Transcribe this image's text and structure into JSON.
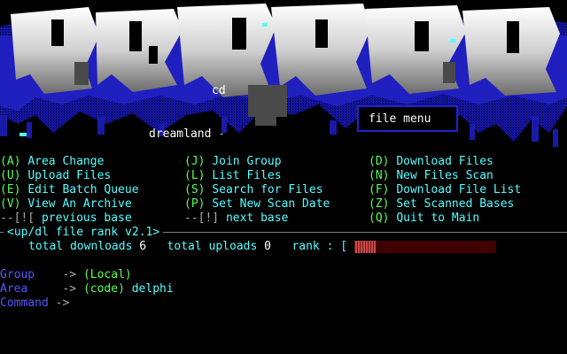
{
  "banner": {
    "tag": "cd",
    "menu_title": "file menu",
    "bbs_name": "dreamland",
    "bbs_suffix": "-"
  },
  "menu": {
    "col1": [
      {
        "key": "(A)",
        "label": "Area Change"
      },
      {
        "key": "(U)",
        "label": "Upload Files"
      },
      {
        "key": "(E)",
        "label": "Edit Batch Queue"
      },
      {
        "key": "(V)",
        "label": "View An Archive"
      },
      {
        "key": "--[![",
        "label": "previous base"
      }
    ],
    "col2": [
      {
        "key": "(J)",
        "label": "Join Group"
      },
      {
        "key": "(L)",
        "label": "List Files"
      },
      {
        "key": "(S)",
        "label": "Search for Files"
      },
      {
        "key": "(P)",
        "label": "Set New Scan Date"
      },
      {
        "key": "--[!]",
        "label": "next base"
      }
    ],
    "col3": [
      {
        "key": "(D)",
        "label": "Download Files"
      },
      {
        "key": "(N)",
        "label": "New Files Scan"
      },
      {
        "key": "(F)",
        "label": "Download File List"
      },
      {
        "key": "(Z)",
        "label": "Set Scanned Bases"
      },
      {
        "key": "(Q)",
        "label": "Quit to Main"
      }
    ]
  },
  "rank_panel": {
    "title": "<up/dl file rank v2.1>",
    "downloads_label": "total downloads",
    "downloads": "6",
    "uploads_label": "total uploads",
    "uploads": "0",
    "rank_label": "rank : [",
    "rank_fraction": 0.15
  },
  "status": {
    "group_label": "Group",
    "group_arrow": "->",
    "group_value": "(Local)",
    "area_label": "Area",
    "area_arrow": "->",
    "area_code": "(code)",
    "area_name": "delphi",
    "command_label": "Command",
    "command_arrow": "->"
  },
  "colors": {
    "key": "#55ff55",
    "text": "#55ffff",
    "label": "#5555ff",
    "bar_fill": "#c84a4a",
    "bar_empty": "#3a0000",
    "art_blue": "#1a1aa8",
    "art_light": "#d8d8d8"
  }
}
